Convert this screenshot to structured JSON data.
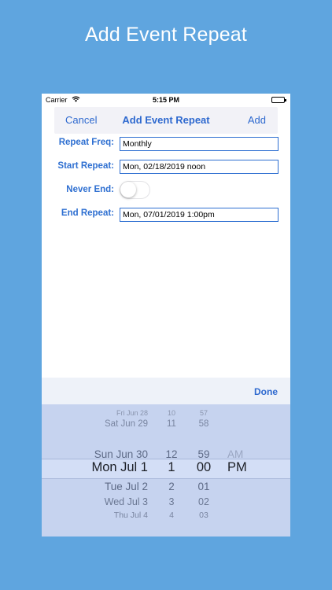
{
  "caption": "Add Event Repeat",
  "status_bar": {
    "carrier": "Carrier",
    "time": "5:15 PM"
  },
  "nav": {
    "cancel": "Cancel",
    "title": "Add Event Repeat",
    "add": "Add"
  },
  "form": {
    "repeat_freq": {
      "label": "Repeat Freq:",
      "value": "Monthly"
    },
    "start_repeat": {
      "label": "Start Repeat:",
      "value": "Mon, 02/18/2019 noon"
    },
    "never_end": {
      "label": "Never End:",
      "on": false
    },
    "end_repeat": {
      "label": "End Repeat:",
      "value": "Mon, 07/01/2019 1:00pm"
    }
  },
  "toolbar": {
    "done": "Done"
  },
  "picker": {
    "dates": [
      "Fri Jun 28",
      "Sat Jun 29",
      "Sun Jun 30",
      "Mon Jul 1",
      "Tue Jul 2",
      "Wed Jul 3",
      "Thu Jul 4"
    ],
    "hours": [
      "10",
      "11",
      "12",
      "1",
      "2",
      "3",
      "4"
    ],
    "minutes": [
      "57",
      "58",
      "59",
      "00",
      "01",
      "02",
      "03"
    ],
    "ampm": [
      "AM",
      "PM"
    ],
    "selected_index": 3
  }
}
